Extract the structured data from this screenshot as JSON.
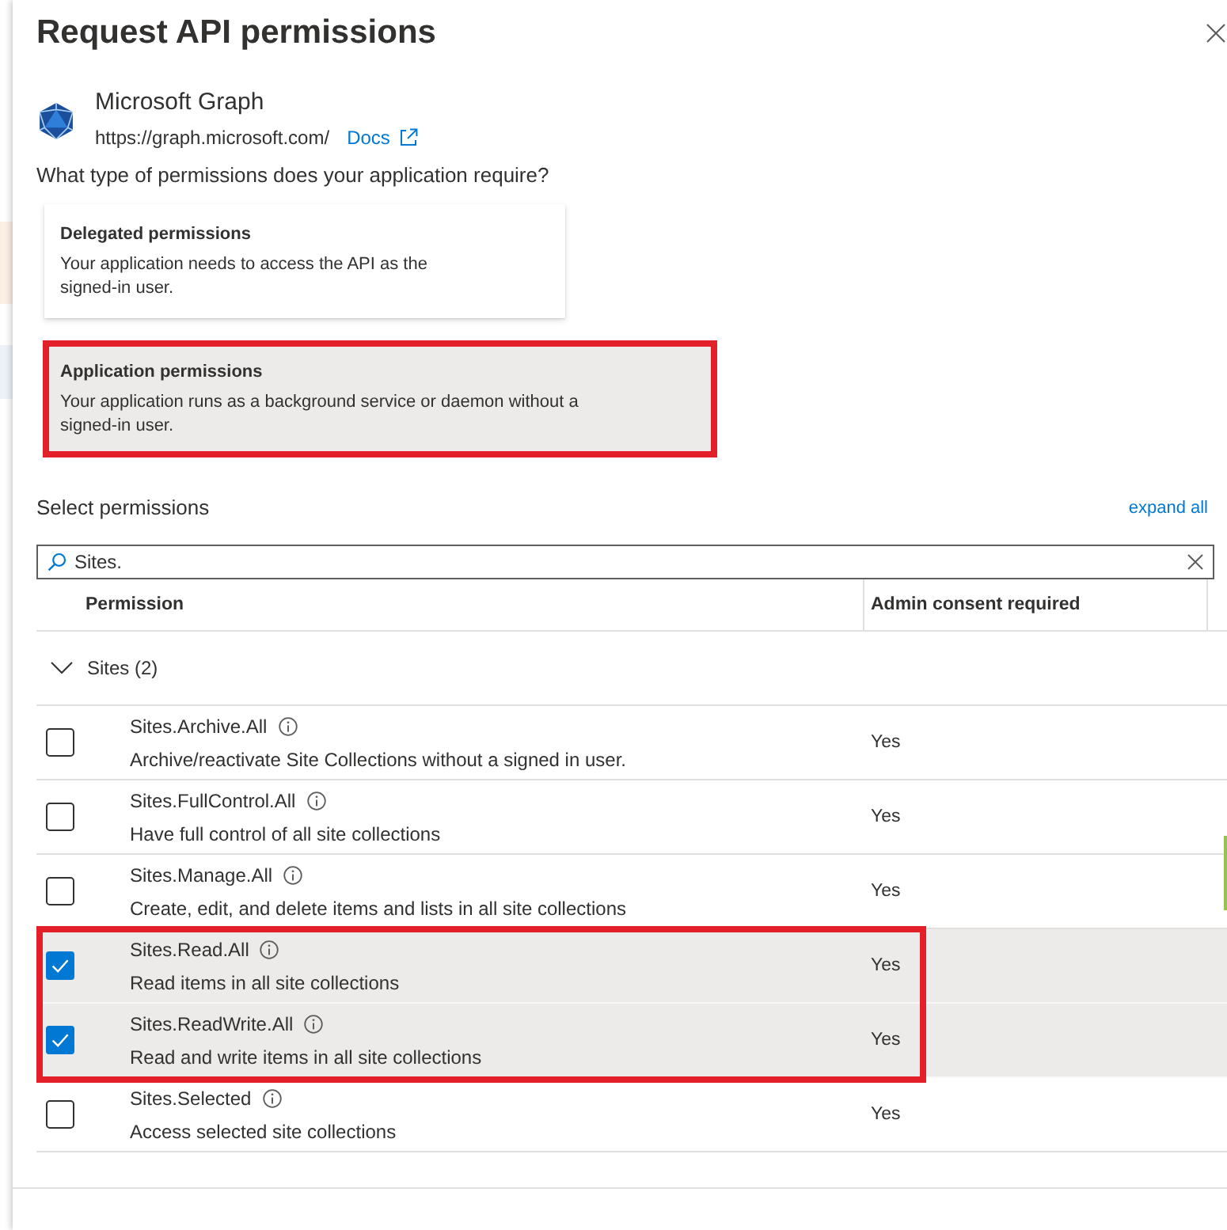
{
  "panel": {
    "title": "Request API permissions"
  },
  "api": {
    "name": "Microsoft Graph",
    "url": "https://graph.microsoft.com/",
    "docs_link": "Docs"
  },
  "question": "What type of permissions does your application require?",
  "permission_types": [
    {
      "title": "Delegated permissions",
      "description": "Your application needs to access the API as the\nsigned-in user.",
      "selected": false,
      "highlighted": false
    },
    {
      "title": "Application permissions",
      "description": "Your application runs as a background service or daemon without a\nsigned-in user.",
      "selected": true,
      "highlighted": true
    }
  ],
  "select_permissions": {
    "label": "Select permissions",
    "expand_link": "expand all",
    "search": {
      "value": "Sites."
    }
  },
  "table": {
    "columns": [
      "Permission",
      "Admin consent required"
    ],
    "groups": [
      {
        "label": "Sites (2)",
        "expanded": true,
        "rows": [
          {
            "name": "Sites.Archive.All",
            "description": "Archive/reactivate Site Collections without a signed in user.",
            "admin_consent": "Yes",
            "checked": false,
            "highlighted": false
          },
          {
            "name": "Sites.FullControl.All",
            "description": "Have full control of all site collections",
            "admin_consent": "Yes",
            "checked": false,
            "highlighted": false
          },
          {
            "name": "Sites.Manage.All",
            "description": "Create, edit, and delete items and lists in all site collections",
            "admin_consent": "Yes",
            "checked": false,
            "highlighted": false
          },
          {
            "name": "Sites.Read.All",
            "description": "Read items in all site collections",
            "admin_consent": "Yes",
            "checked": true,
            "highlighted": true
          },
          {
            "name": "Sites.ReadWrite.All",
            "description": "Read and write items in all site collections",
            "admin_consent": "Yes",
            "checked": true,
            "highlighted": true
          },
          {
            "name": "Sites.Selected",
            "description": "Access selected site collections",
            "admin_consent": "Yes",
            "checked": false,
            "highlighted": false
          }
        ]
      }
    ]
  }
}
